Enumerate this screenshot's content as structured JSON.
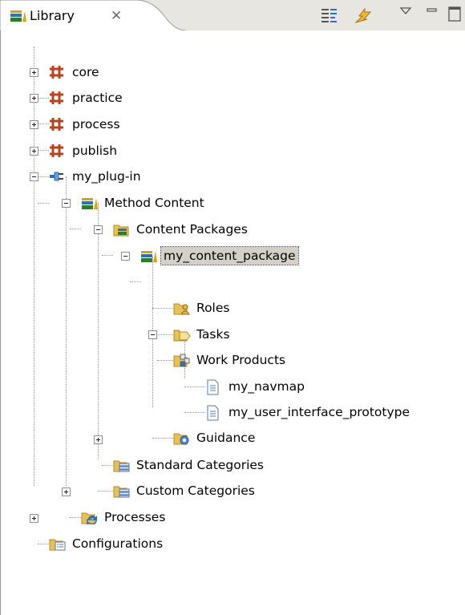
{
  "tab": {
    "label": "Library",
    "close": "✕"
  },
  "toolbar": {
    "buttons": [
      "link-editor-icon",
      "sync-icon",
      "view-menu-icon",
      "minimize-icon",
      "maximize-icon"
    ]
  },
  "tree": {
    "items": [
      {
        "label": "core",
        "icon": "plugin-package-icon",
        "expanded": false
      },
      {
        "label": "practice",
        "icon": "plugin-package-icon",
        "expanded": false
      },
      {
        "label": "process",
        "icon": "plugin-package-icon",
        "expanded": false
      },
      {
        "label": "publish",
        "icon": "plugin-package-icon",
        "expanded": false
      },
      {
        "label": "my_plug-in",
        "icon": "plug-in-icon",
        "expanded": true
      },
      {
        "label": "Method Content",
        "icon": "method-content-icon",
        "expanded": true
      },
      {
        "label": "Content Packages",
        "icon": "content-packages-folder-icon",
        "expanded": true
      },
      {
        "label": "my_content_package",
        "icon": "content-package-icon",
        "expanded": true,
        "selected": true
      },
      {
        "label": "Roles",
        "icon": "roles-folder-icon"
      },
      {
        "label": "Tasks",
        "icon": "tasks-folder-icon"
      },
      {
        "label": "Work Products",
        "icon": "work-products-folder-icon",
        "expanded": true
      },
      {
        "label": "my_navmap",
        "icon": "artifact-icon"
      },
      {
        "label": "my_user_interface_prototype",
        "icon": "artifact-icon"
      },
      {
        "label": "Guidance",
        "icon": "guidance-folder-icon"
      },
      {
        "label": "Standard Categories",
        "icon": "categories-folder-icon",
        "expanded": false
      },
      {
        "label": "Custom Categories",
        "icon": "categories-folder-icon"
      },
      {
        "label": "Processes",
        "icon": "processes-folder-icon",
        "expanded": false
      },
      {
        "label": "Configurations",
        "icon": "configurations-folder-icon",
        "expanded": false
      }
    ]
  },
  "colors": {
    "header_bg": "#e8e6e1",
    "selection_bg": "#d4d0c8",
    "package_color": "#b5451f",
    "folder_color": "#e6c15a"
  }
}
